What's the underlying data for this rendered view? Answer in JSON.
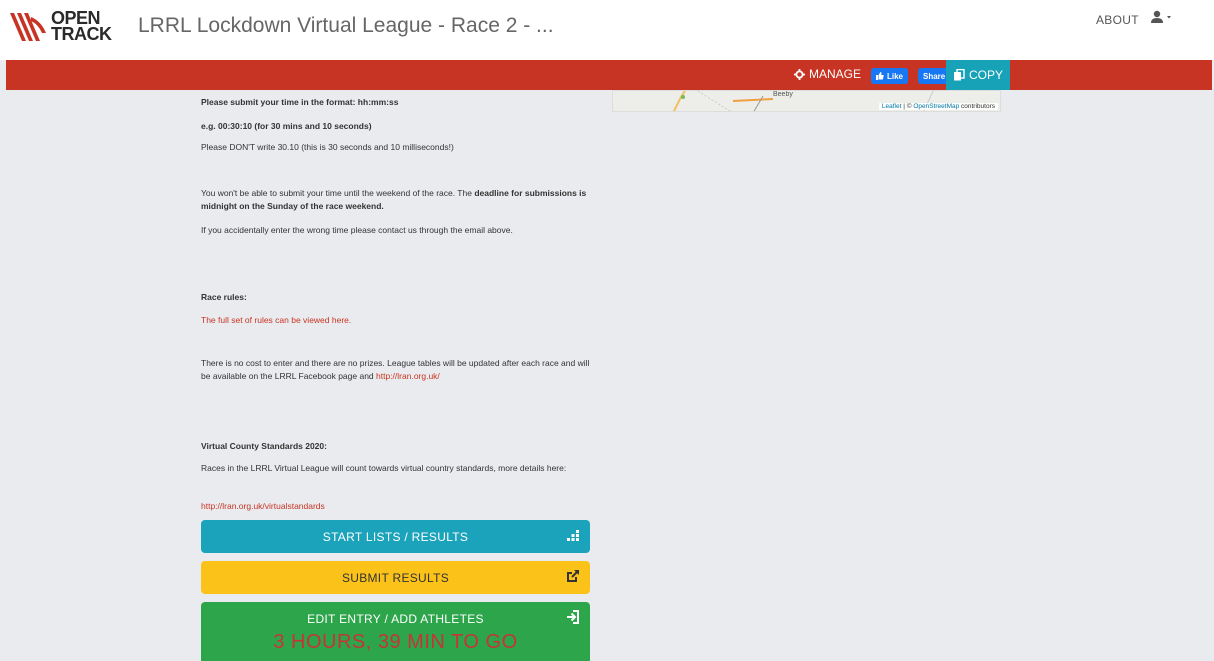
{
  "header": {
    "logo_text_top": "OPEN",
    "logo_text_bottom": "TRACK",
    "title": "LRRL Lockdown Virtual League - Race 2 - ...",
    "about": "ABOUT"
  },
  "toolbar": {
    "manage": "MANAGE",
    "fb_like": "Like",
    "fb_share": "Share",
    "copy": "COPY"
  },
  "map": {
    "place": "Beeby",
    "credit_leaflet": "Leaflet",
    "credit_sep": " | © ",
    "credit_osm": "OpenStreetMap",
    "credit_suffix": " contributors"
  },
  "body": {
    "format_heading": "Please submit your time in the format: hh:mm:ss",
    "example": "e.g. 00:30:10 (for 30 mins and 10 seconds)",
    "dont": "Please DON'T write 30.10 (this is 30 seconds and 10 milliseconds!)",
    "deadline_pre": "You won't be able to submit your time until the weekend of the race. The ",
    "deadline_bold": "deadline for submissions is midnight on the Sunday of the race weekend.",
    "wrong_time": "If you accidentally enter the wrong time please contact us through the email above.",
    "rules_heading": "Race rules:",
    "rules_link": "The full set of rules can be viewed here.",
    "cost_pre": "There is no cost to enter and there are no prizes. League tables will be updated after each race and will be available on the LRRL Facebook page and ",
    "cost_link": "http://lran.org.uk/",
    "standards_heading": "Virtual County Standards 2020:",
    "standards_text": "Races in the LRRL Virtual League will count towards virtual country standards, more details here:",
    "standards_link": "http://lran.org.uk/virtualstandards"
  },
  "buttons": {
    "start_lists": "START LISTS / RESULTS",
    "submit_results": "SUBMIT RESULTS",
    "edit_entry": "EDIT ENTRY / ADD ATHLETES",
    "countdown": "3 HOURS, 39 MIN TO GO"
  },
  "colors": {
    "brand_red": "#c83424",
    "info": "#1aa3bb",
    "warning": "#fbc21a",
    "success": "#2da54a"
  },
  "icons": [
    "opentrack-logo",
    "user-icon",
    "gear-icon",
    "thumbs-up-icon",
    "copy-icon",
    "results-icon",
    "external-link-icon",
    "sign-in-icon"
  ]
}
